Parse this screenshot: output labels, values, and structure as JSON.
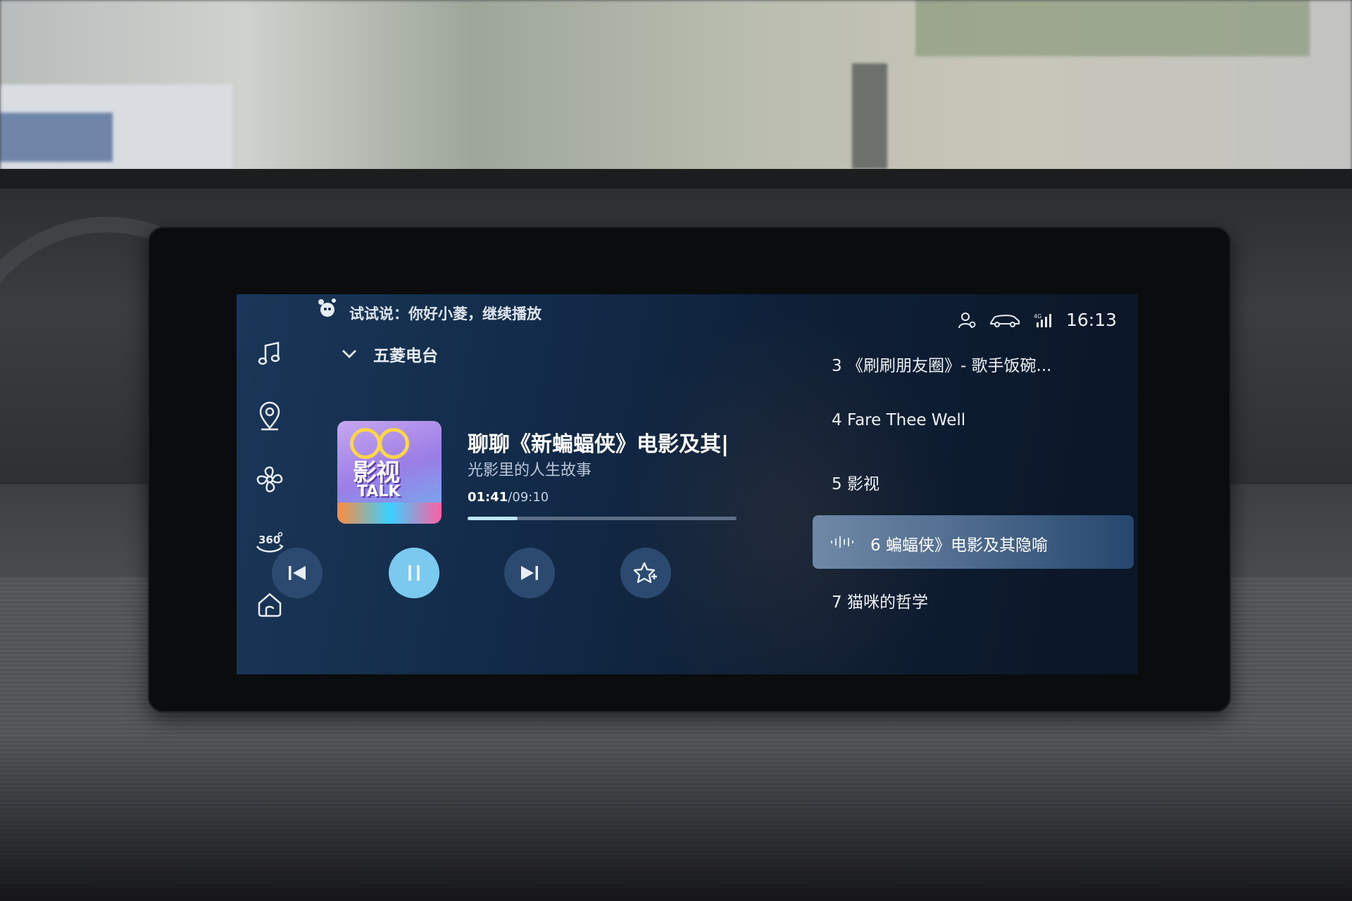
{
  "colors": {
    "screen_bg": "#122a48",
    "accent": "#7cc9f0",
    "button_bg": "#2c4a70",
    "progress_fill": "#bfe8ff",
    "active_item_bg": "#5a7596"
  },
  "status_bar": {
    "voice_hint": "试试说：你好小菱，继续播放",
    "hint_icon": "assistant-mascot-icon",
    "icons": [
      "user-profile-icon",
      "car-icon",
      "signal-strength-icon"
    ],
    "time": "16:13"
  },
  "rail": {
    "items": [
      {
        "icon": "music-note-icon"
      },
      {
        "icon": "map-pin-icon"
      },
      {
        "icon": "fan-icon"
      },
      {
        "icon": "camera-360-icon",
        "label": "360"
      },
      {
        "icon": "home-icon"
      }
    ]
  },
  "source": {
    "label": "五菱电台",
    "icon": "chevron-down-icon"
  },
  "now_playing": {
    "cover_text_line1": "影视",
    "cover_text_line2": "TALK",
    "title": "聊聊《新蝙蝠侠》电影及其|",
    "subtitle": "光影里的人生故事",
    "current_time": "01:41",
    "separator": "/",
    "total_time": "09:10",
    "progress_fraction": 0.185
  },
  "controls": {
    "prev_icon": "skip-previous-icon",
    "play_pause_icon": "pause-icon",
    "next_icon": "skip-next-icon",
    "favorite_icon": "star-add-icon"
  },
  "playlist": {
    "items": [
      {
        "text": "3 《刷刷朋友圈》- 歌手饭碗..."
      },
      {
        "text": "4 Fare Thee Well"
      },
      {
        "text": "5 影视"
      },
      {
        "text": "6  蝙蝠侠》电影及其隐喻",
        "active": true
      },
      {
        "text": "7 猫咪的哲学"
      }
    ]
  }
}
